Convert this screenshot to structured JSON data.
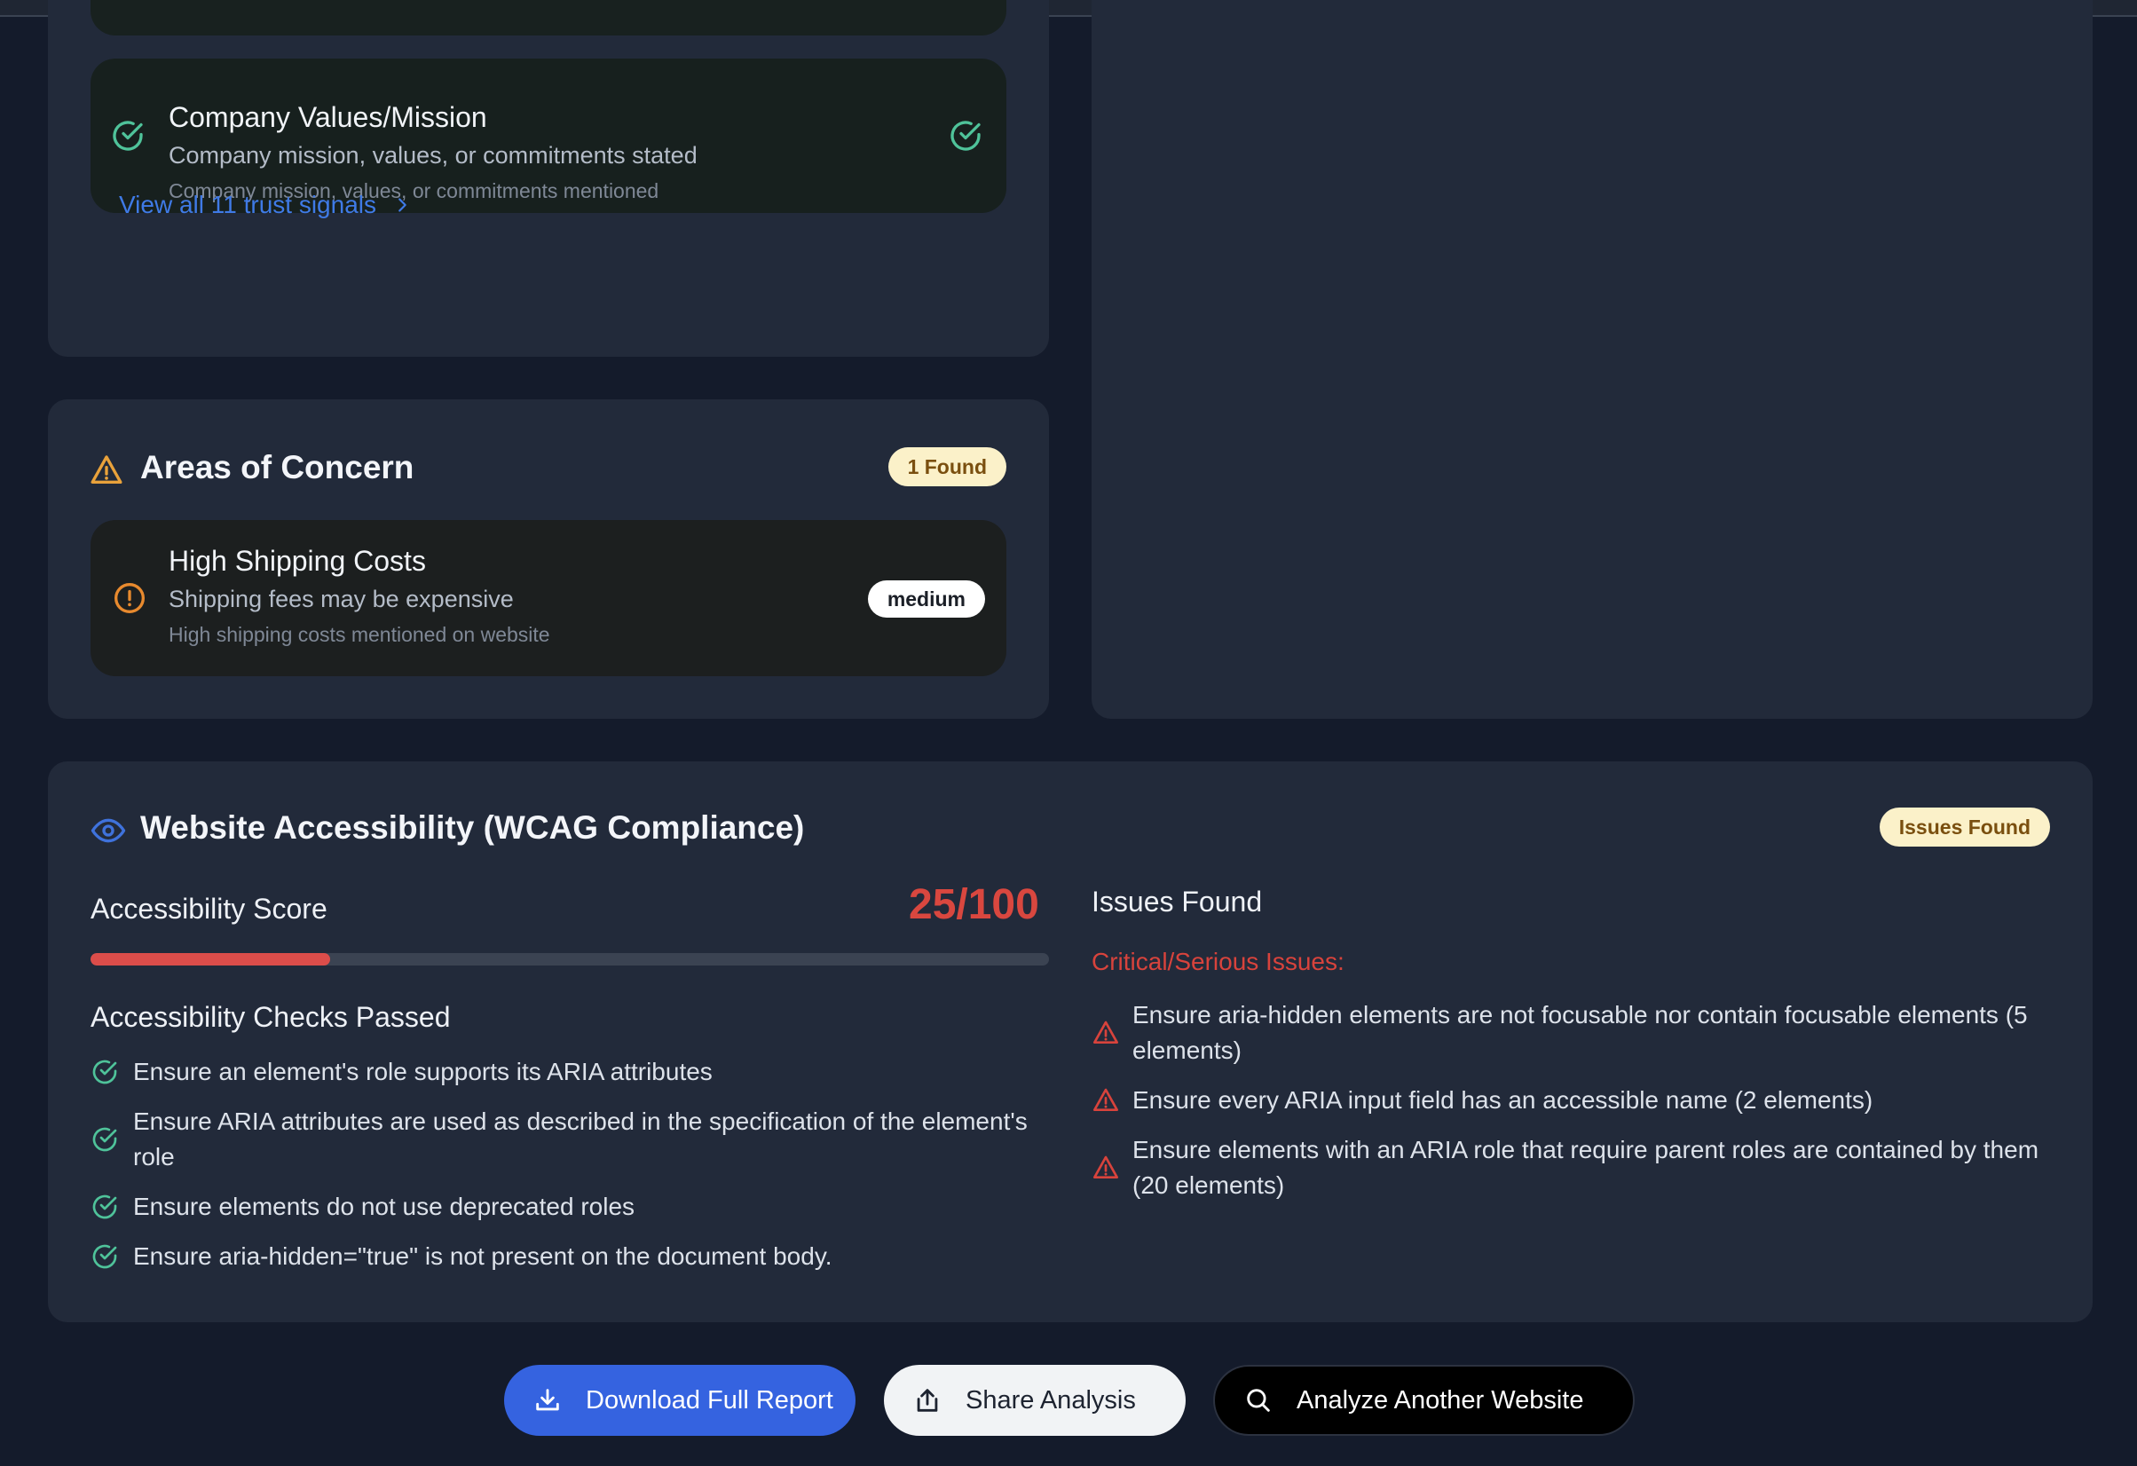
{
  "trust_signals": {
    "item": {
      "title": "Company Values/Mission",
      "subtitle": "Company mission, values, or commitments stated",
      "note": "Company mission, values, or commitments mentioned"
    },
    "view_all_label": "View all 11 trust signals"
  },
  "concerns": {
    "title": "Areas of Concern",
    "badge": "1 Found",
    "item": {
      "title": "High Shipping Costs",
      "subtitle": "Shipping fees may be expensive",
      "note": "High shipping costs mentioned on website",
      "severity": "medium"
    }
  },
  "accessibility": {
    "title": "Website Accessibility (WCAG Compliance)",
    "badge": "Issues Found",
    "score_label": "Accessibility Score",
    "score_text": "25/100",
    "score_value": 25,
    "score_max": 100,
    "passed_heading": "Accessibility Checks Passed",
    "passed": [
      "Ensure an element's role supports its ARIA attributes",
      "Ensure ARIA attributes are used as described in the specification of the element's role",
      "Ensure elements do not use deprecated roles",
      "Ensure aria-hidden=\"true\" is not present on the document body."
    ],
    "issues_heading": "Issues Found",
    "critical_label": "Critical/Serious Issues:",
    "issues": [
      "Ensure aria-hidden elements are not focusable nor contain focusable elements (5 elements)",
      "Ensure every ARIA input field has an accessible name (2 elements)",
      "Ensure elements with an ARIA role that require parent roles are contained by them (20 elements)"
    ]
  },
  "actions": {
    "download": "Download Full Report",
    "share": "Share Analysis",
    "analyze": "Analyze Another Website"
  },
  "colors": {
    "success": "#4fc39a",
    "warning": "#e9a23b",
    "danger": "#d8433c",
    "accent": "#3563e0"
  },
  "icons": [
    "check-circle-icon",
    "chevron-right-icon",
    "warning-triangle-icon",
    "alert-circle-icon",
    "eye-icon",
    "download-icon",
    "share-icon",
    "search-icon"
  ]
}
